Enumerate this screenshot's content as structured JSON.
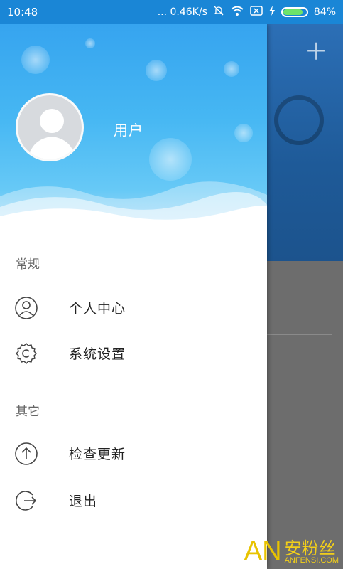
{
  "status_bar": {
    "time": "10:48",
    "network_speed": "... 0.46K/s",
    "battery_percent": "84%",
    "battery_level": 0.84,
    "icons": [
      "mute-icon",
      "wifi-icon",
      "sim-icon",
      "charging-icon",
      "battery-icon"
    ]
  },
  "header": {
    "username": "用户"
  },
  "sections": [
    {
      "title": "常规",
      "items": [
        {
          "label": "个人中心",
          "icon": "person-icon"
        },
        {
          "label": "系统设置",
          "icon": "gear-icon"
        }
      ]
    },
    {
      "title": "其它",
      "items": [
        {
          "label": "检查更新",
          "icon": "arrow-up-icon"
        },
        {
          "label": "退出",
          "icon": "logout-icon"
        }
      ]
    }
  ],
  "background_app": {
    "add_icon": "plus-icon"
  },
  "watermark": {
    "letters": "AN",
    "cn_text": "安粉丝",
    "en_text": "ANFENSI.COM"
  },
  "colors": {
    "status_bar": "#1a86d6",
    "header_top": "#36a4ef",
    "battery_fill": "#6ee36a",
    "watermark": "#e8c300"
  }
}
